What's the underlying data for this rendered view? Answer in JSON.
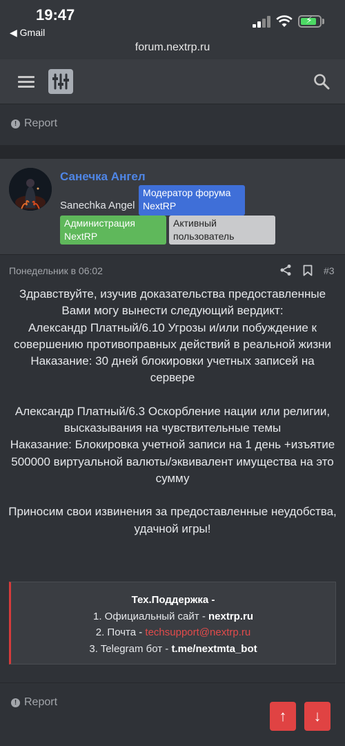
{
  "status_bar": {
    "time": "19:47",
    "back_app": "◀ Gmail",
    "url": "forum.nextrp.ru"
  },
  "nav": {
    "menu_icon": "hamburger-icon",
    "logo_icon": "sliders-icon",
    "search_icon": "search-icon"
  },
  "report_label": "Report",
  "post": {
    "author_display": "Санечка Ангел",
    "author_name": "Sanechka Angel",
    "badges": {
      "moderator": "Модератор форума NextRP",
      "admin": "Администрация NextRP",
      "active": "Активный пользователь"
    },
    "date": "Понедельник в 06:02",
    "number": "#3",
    "paragraphs": [
      [
        "Здравствуйте, изучив доказательства предоставленные Вами могу вынести следующий вердикт:",
        "Александр Платный/6.10 Угрозы и/или побуждение к совершению противоправных действий в реальной жизни",
        "Наказание: 30 дней блокировки учетных записей на сервере"
      ],
      [
        "Александр Платный/6.3 Оскорбление нации или религии, высказывания на чувствительные темы",
        "Наказание: Блокировка учетной записи на 1 день +изъятие 500000 виртуальной валюты/эквивалент имущества на это сумму"
      ],
      [
        "Приносим свои извинения за предоставленные неудобства, удачной игры!"
      ]
    ],
    "support": {
      "title": "Тех.Поддержка -",
      "line1_prefix": "1. Официальный сайт - ",
      "line1_value": "nextrp.ru",
      "line2_prefix": "2. Почта - ",
      "line2_value": "techsupport@nextrp.ru",
      "line3_prefix": "3. Telegram бот - ",
      "line3_value": "t.me/nextmta_bot"
    }
  },
  "scroll": {
    "up": "↑",
    "down": "↓"
  }
}
